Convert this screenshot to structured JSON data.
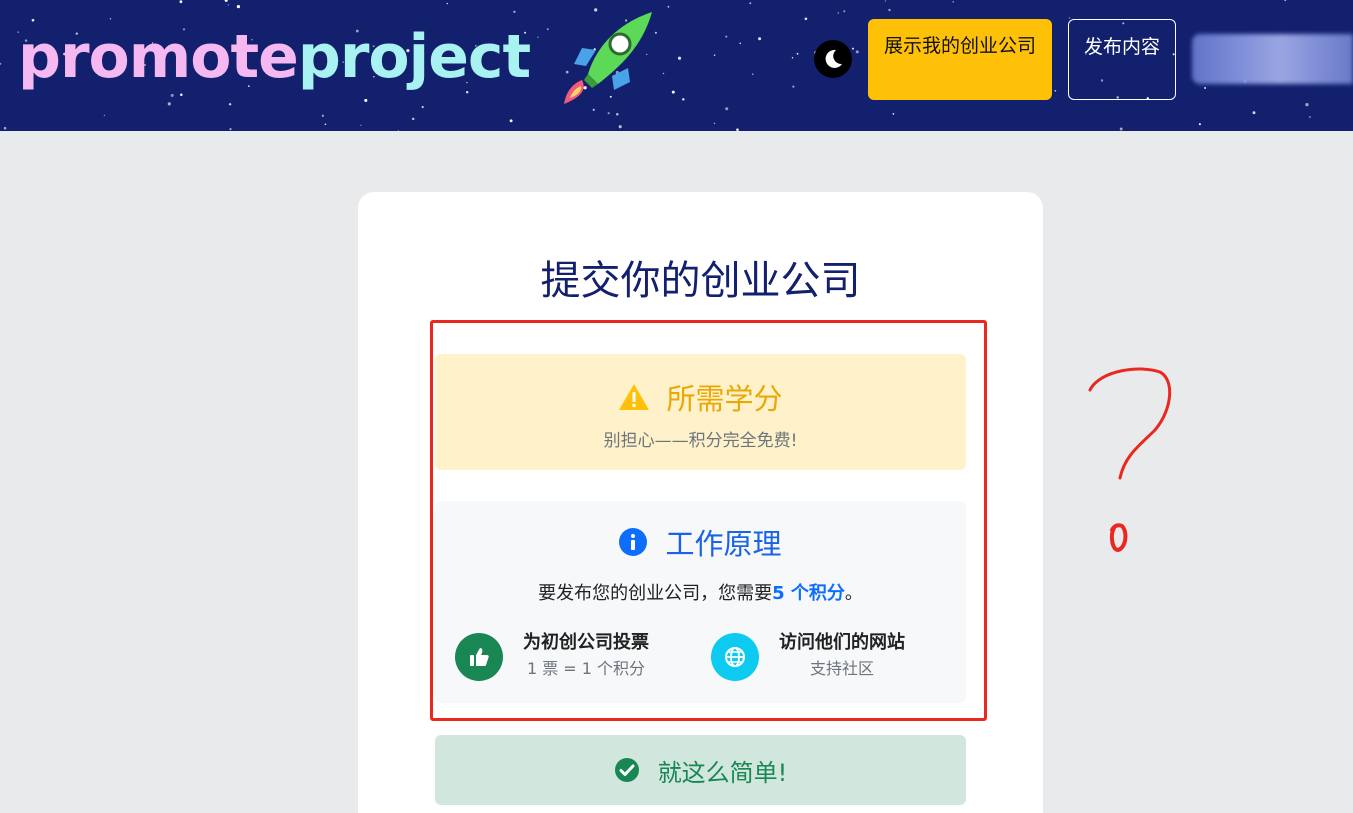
{
  "header": {
    "logo_part1": "promote",
    "logo_part2": "project",
    "rocket_icon": "rocket-icon",
    "theme_toggle_icon": "moon-icon",
    "show_startup_button": "展示我的创业公司",
    "publish_button": "发布内容"
  },
  "card": {
    "title": "提交你的创业公司",
    "credits": {
      "icon": "warning-icon",
      "heading": "所需学分",
      "subtext": "别担心——积分完全免费!"
    },
    "how_it_works": {
      "icon": "info-icon",
      "heading": "工作原理",
      "line_prefix": "要发布您的创业公司，您需要",
      "line_highlight": "5 个积分",
      "line_suffix": "。",
      "features": [
        {
          "icon": "thumbs-up-icon",
          "title": "为初创公司投票",
          "subtitle": "1 票 = 1 个积分"
        },
        {
          "icon": "globe-icon",
          "title": "访问他们的网站",
          "subtitle": "支持社区"
        }
      ]
    },
    "simple": {
      "icon": "check-circle-icon",
      "text": "就这么简单!"
    }
  },
  "colors": {
    "header_bg": "#12206e",
    "accent_yellow": "#ffc107",
    "info_blue": "#1a62e8",
    "success_green": "#198754",
    "annotation_red": "#ea2820"
  }
}
